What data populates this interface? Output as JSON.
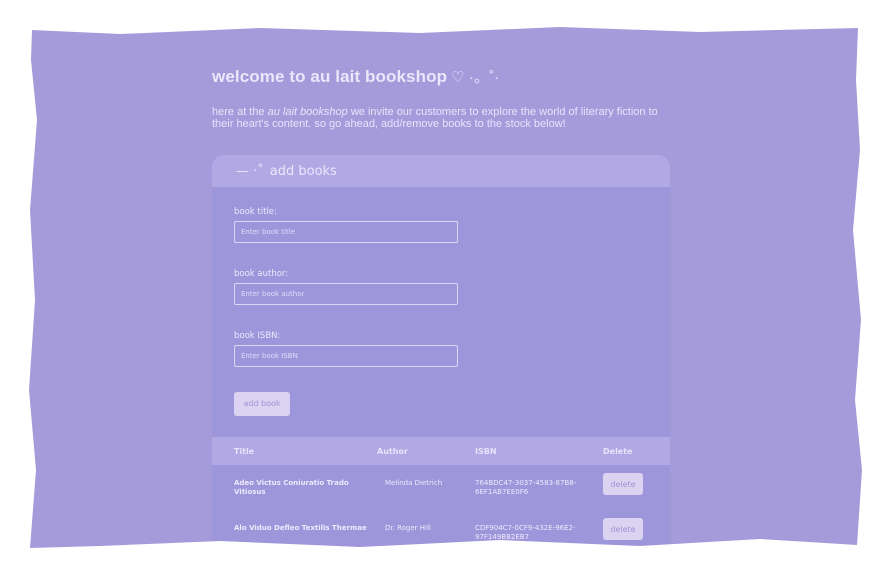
{
  "page": {
    "title": "welcome to au lait bookshop",
    "title_deco": "♡ ·。˚·",
    "intro_before": "here at the ",
    "intro_em": "au lait bookshop",
    "intro_after": " we invite our customers to explore the world of literary fiction to their heart's content. so go ahead, add/remove books to the stock below!"
  },
  "add_books": {
    "heading_deco": "— ·˚",
    "heading": "add books",
    "title_label": "book title:",
    "title_placeholder": "Enter book title",
    "author_label": "book author:",
    "author_placeholder": "Enter book author",
    "isbn_label": "book ISBN:",
    "isbn_placeholder": "Enter book ISBN",
    "submit_label": "add book"
  },
  "table": {
    "headers": {
      "title": "Title",
      "author": "Author",
      "isbn": "ISBN",
      "delete": "Delete"
    },
    "rows": [
      {
        "title": "Adeo Victus Coniuratio Trado Vitiosus",
        "author": "Melinda Dietrich",
        "isbn": "764BDC47-3037-4583-87B8-6EF1AB7EE0F6",
        "delete_label": "delete"
      },
      {
        "title": "Alo Viduo Defleo Textilis Thermae",
        "author": "Dr. Roger Hill",
        "isbn": "CDF904C7-0CF9-432E-96E2-97F149BB2EB7",
        "delete_label": "delete"
      }
    ]
  },
  "colors": {
    "paper": "#a59bdb",
    "card": "#9e96db",
    "card_header": "#b2a8e3",
    "button": "#dcd3f2",
    "text": "#ece6fb"
  }
}
